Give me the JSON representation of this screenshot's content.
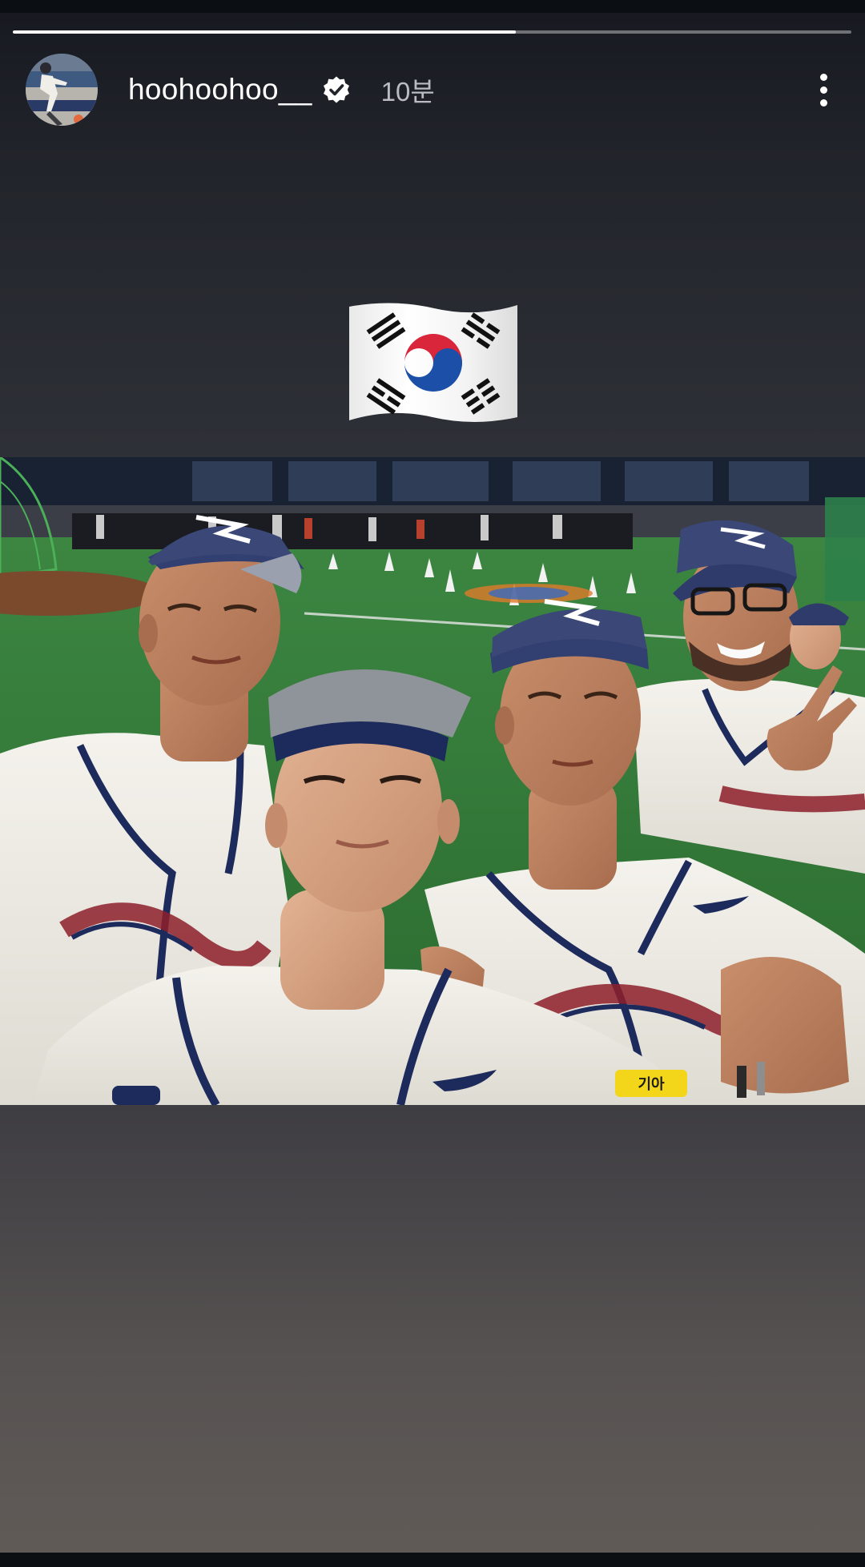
{
  "story": {
    "progress": 0.6,
    "author": {
      "username": "hoohoohoo__",
      "verified": true,
      "time_ago": "10분",
      "avatar_icon": "avatar-photo"
    },
    "menu_icon": "more-vertical-icon",
    "sticker": {
      "emoji": "🇰🇷",
      "name": "south-korea-flag"
    },
    "photo": {
      "patch_text": "기아"
    },
    "colors": {
      "background_top": "#16191f",
      "background_bottom": "#605a57",
      "progress_fill": "#ffffff",
      "text": "#ffffff",
      "secondary_text": "#b9bcc3"
    }
  }
}
